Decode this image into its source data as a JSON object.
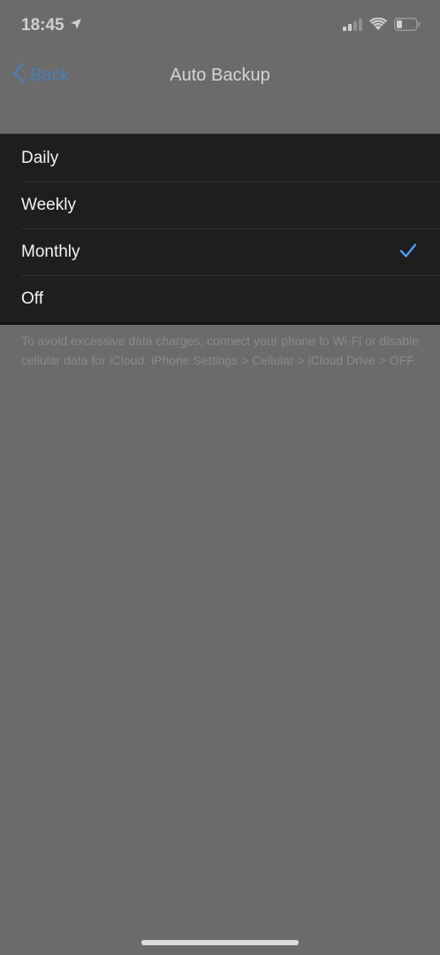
{
  "status_bar": {
    "time": "18:45",
    "icons": [
      "location-arrow-icon",
      "cellular-signal-icon",
      "wifi-icon",
      "battery-icon"
    ]
  },
  "nav": {
    "back_label": "Back",
    "title": "Auto Backup"
  },
  "options": [
    {
      "label": "Daily",
      "selected": false
    },
    {
      "label": "Weekly",
      "selected": false
    },
    {
      "label": "Monthly",
      "selected": true
    },
    {
      "label": "Off",
      "selected": false
    }
  ],
  "footer_note": "To avoid excessive data charges, connect your phone to Wi-Fi or disable cellular data for iCloud. iPhone Settings > Cellular > iCloud Drive > OFF.",
  "colors": {
    "background": "#6b6b6b",
    "list_background": "#1e1e1e",
    "accent": "#4a9eff",
    "back_tint": "#4a7fb5"
  }
}
